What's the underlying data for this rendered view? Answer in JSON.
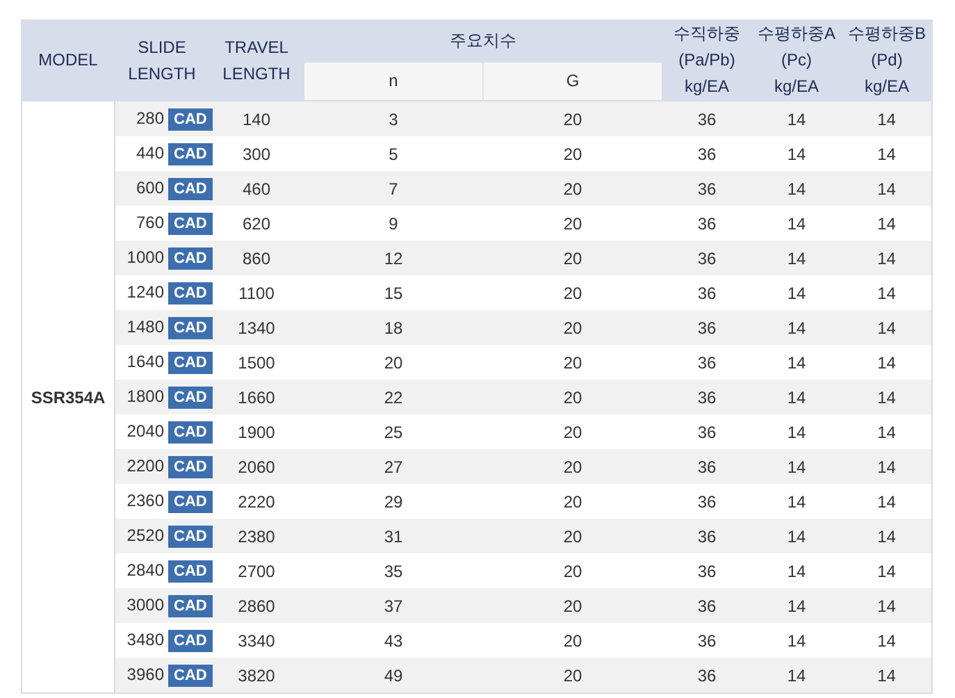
{
  "table": {
    "columns": [
      {
        "label": "MODEL"
      },
      {
        "label": "SLIDE\nLENGTH"
      },
      {
        "label": "TRAVEL\nLENGTH"
      },
      {
        "label": "주요치수",
        "sub": [
          "n",
          "G"
        ]
      },
      {
        "label": "수직하중\n(Pa/Pb)\nkg/EA"
      },
      {
        "label": "수평하중A\n(Pc)\nkg/EA"
      },
      {
        "label": "수평하중B\n(Pd)\nkg/EA"
      }
    ],
    "model": "SSR354A",
    "rows": [
      {
        "slide": "280",
        "cad": "CAD",
        "travel": "140",
        "n": "3",
        "g": "20",
        "v": "36",
        "a": "14",
        "b": "14"
      },
      {
        "slide": "440",
        "cad": "CAD",
        "travel": "300",
        "n": "5",
        "g": "20",
        "v": "36",
        "a": "14",
        "b": "14"
      },
      {
        "slide": "600",
        "cad": "CAD",
        "travel": "460",
        "n": "7",
        "g": "20",
        "v": "36",
        "a": "14",
        "b": "14"
      },
      {
        "slide": "760",
        "cad": "CAD",
        "travel": "620",
        "n": "9",
        "g": "20",
        "v": "36",
        "a": "14",
        "b": "14"
      },
      {
        "slide": "1000",
        "cad": "CAD",
        "travel": "860",
        "n": "12",
        "g": "20",
        "v": "36",
        "a": "14",
        "b": "14"
      },
      {
        "slide": "1240",
        "cad": "CAD",
        "travel": "1100",
        "n": "15",
        "g": "20",
        "v": "36",
        "a": "14",
        "b": "14"
      },
      {
        "slide": "1480",
        "cad": "CAD",
        "travel": "1340",
        "n": "18",
        "g": "20",
        "v": "36",
        "a": "14",
        "b": "14"
      },
      {
        "slide": "1640",
        "cad": "CAD",
        "travel": "1500",
        "n": "20",
        "g": "20",
        "v": "36",
        "a": "14",
        "b": "14"
      },
      {
        "slide": "1800",
        "cad": "CAD",
        "travel": "1660",
        "n": "22",
        "g": "20",
        "v": "36",
        "a": "14",
        "b": "14"
      },
      {
        "slide": "2040",
        "cad": "CAD",
        "travel": "1900",
        "n": "25",
        "g": "20",
        "v": "36",
        "a": "14",
        "b": "14"
      },
      {
        "slide": "2200",
        "cad": "CAD",
        "travel": "2060",
        "n": "27",
        "g": "20",
        "v": "36",
        "a": "14",
        "b": "14"
      },
      {
        "slide": "2360",
        "cad": "CAD",
        "travel": "2220",
        "n": "29",
        "g": "20",
        "v": "36",
        "a": "14",
        "b": "14"
      },
      {
        "slide": "2520",
        "cad": "CAD",
        "travel": "2380",
        "n": "31",
        "g": "20",
        "v": "36",
        "a": "14",
        "b": "14"
      },
      {
        "slide": "2840",
        "cad": "CAD",
        "travel": "2700",
        "n": "35",
        "g": "20",
        "v": "36",
        "a": "14",
        "b": "14"
      },
      {
        "slide": "3000",
        "cad": "CAD",
        "travel": "2860",
        "n": "37",
        "g": "20",
        "v": "36",
        "a": "14",
        "b": "14"
      },
      {
        "slide": "3480",
        "cad": "CAD",
        "travel": "3340",
        "n": "43",
        "g": "20",
        "v": "36",
        "a": "14",
        "b": "14"
      },
      {
        "slide": "3960",
        "cad": "CAD",
        "travel": "3820",
        "n": "49",
        "g": "20",
        "v": "36",
        "a": "14",
        "b": "14"
      }
    ]
  }
}
